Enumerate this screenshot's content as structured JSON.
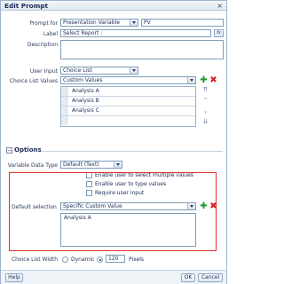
{
  "dialog": {
    "title": "Edit Prompt",
    "close_glyph": "×"
  },
  "form": {
    "prompt_for_label": "Prompt for",
    "prompt_for_value": "Presentation Variable",
    "variable_name": "PV",
    "fx_label": "fx",
    "label_label": "Label",
    "label_value": "Select Report :",
    "description_label": "Description",
    "user_input_label": "User Input",
    "user_input_value": "Choice List",
    "choice_list_values_label": "Choice List Values",
    "choice_list_values_value": "Custom Values",
    "choice_items": [
      "Analysis A",
      "Analysis B",
      "Analysis C",
      ""
    ]
  },
  "options": {
    "section_label": "Options",
    "toggle_glyph": "−",
    "variable_data_type_label": "Variable Data Type",
    "variable_data_type_value": "Default (Text)",
    "multiple_values_label": "Enable user to select multiple values",
    "type_values_label": "Enable user to type values",
    "require_input_label": "Require user input",
    "default_selection_label": "Default selection",
    "default_selection_value": "Specific Custom Value",
    "default_values": [
      "Analysis A"
    ],
    "choice_list_width_label": "Choice List Width",
    "dynamic_label": "Dynamic",
    "width_value": "120",
    "pixels_label": "Pixels"
  },
  "icons": {
    "plus": "✚",
    "delete": "✖",
    "move_top": "⇈",
    "move_up": "⌃",
    "move_down": "⌄",
    "move_bottom": "⇊"
  },
  "footer": {
    "help_label": "Help",
    "ok_label": "OK",
    "cancel_label": "Cancel"
  },
  "colors": {
    "accent": "#1a2b55",
    "highlight_border": "#e0302a",
    "add_green": "#1a9a2a",
    "delete_red": "#d1201b"
  }
}
